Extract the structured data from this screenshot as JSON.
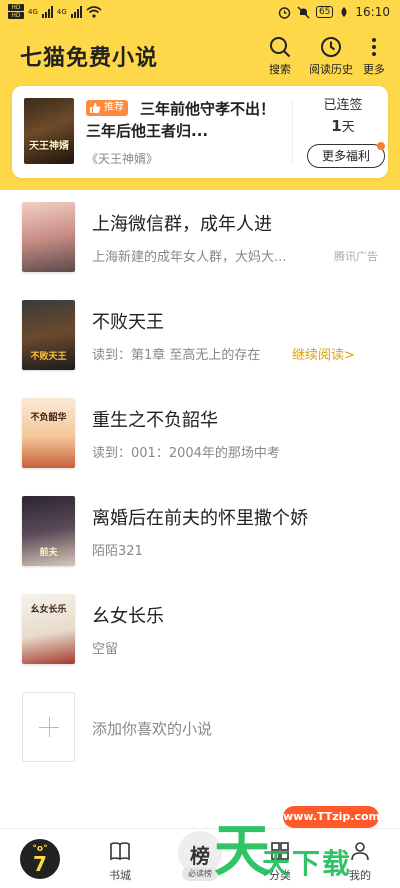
{
  "status_bar": {
    "time": "16:10",
    "battery": "65",
    "sim_labels": [
      "HD",
      "HD"
    ],
    "net_labels": [
      "4G",
      "4G"
    ]
  },
  "header": {
    "title": "七猫免费小说",
    "actions": [
      {
        "label": "搜索",
        "icon": "search-icon"
      },
      {
        "label": "阅读历史",
        "icon": "clock-icon"
      },
      {
        "label": "更多",
        "icon": "more-vertical-icon"
      }
    ]
  },
  "recommendation": {
    "badge": "推荐",
    "cover_text": "天王神婿",
    "title": "三年前他守孝不出！三年后他王者归...",
    "book": "《天王神婿》",
    "streak_label": "已连签",
    "streak_days": "1",
    "streak_unit": "天",
    "benefits_button": "更多福利"
  },
  "shelf": [
    {
      "title": "上海微信群，成年人进",
      "subtitle": "上海新建的成年女人群，大妈大...",
      "tag": "腾讯广告",
      "cover_text": ""
    },
    {
      "title": "不败天王",
      "subtitle": "读到：第1章 至高无上的存在",
      "action": "继续阅读>",
      "cover_text": "不败天王"
    },
    {
      "title": "重生之不负韶华",
      "subtitle": "读到：001：2004年的那场中考",
      "cover_text": "不负韶华"
    },
    {
      "title": "离婚后在前夫的怀里撒个娇",
      "subtitle": "陌陌321",
      "cover_text": "前夫"
    },
    {
      "title": "幺女长乐",
      "subtitle": "空留",
      "cover_text": "幺女长乐"
    }
  ],
  "add_book_label": "添加你喜欢的小说",
  "bottom_nav": {
    "logo_eyes": "°o°",
    "logo_mark": "7",
    "tabs": [
      {
        "label": "书城",
        "icon": "book-icon"
      },
      {
        "label": "必读榜",
        "badge": "榜"
      },
      {
        "label": "分类",
        "icon": "grid-icon"
      },
      {
        "label": "我的",
        "icon": "user-icon"
      }
    ]
  },
  "watermark": {
    "url": "www.TTzip.com",
    "big": "天",
    "small": "天下载"
  }
}
